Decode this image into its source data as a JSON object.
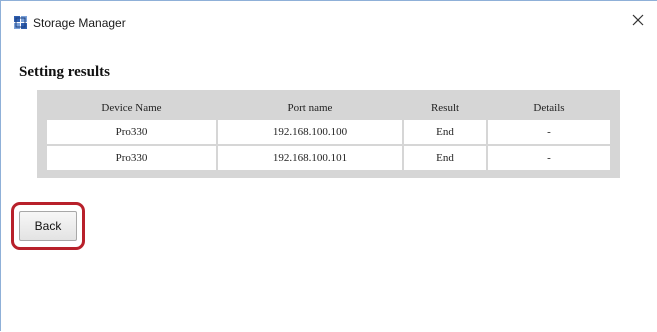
{
  "window": {
    "title": "Storage Manager",
    "icon": "storage-manager-app-icon",
    "close_icon": "close-icon"
  },
  "section": {
    "title": "Setting results"
  },
  "table": {
    "headers": [
      "Device Name",
      "Port name",
      "Result",
      "Details"
    ],
    "rows": [
      [
        "Pro330",
        "192.168.100.100",
        "End",
        "-"
      ],
      [
        "Pro330",
        "192.168.100.101",
        "End",
        "-"
      ]
    ]
  },
  "actions": {
    "back_label": "Back",
    "highlight_color": "#b8202a"
  }
}
